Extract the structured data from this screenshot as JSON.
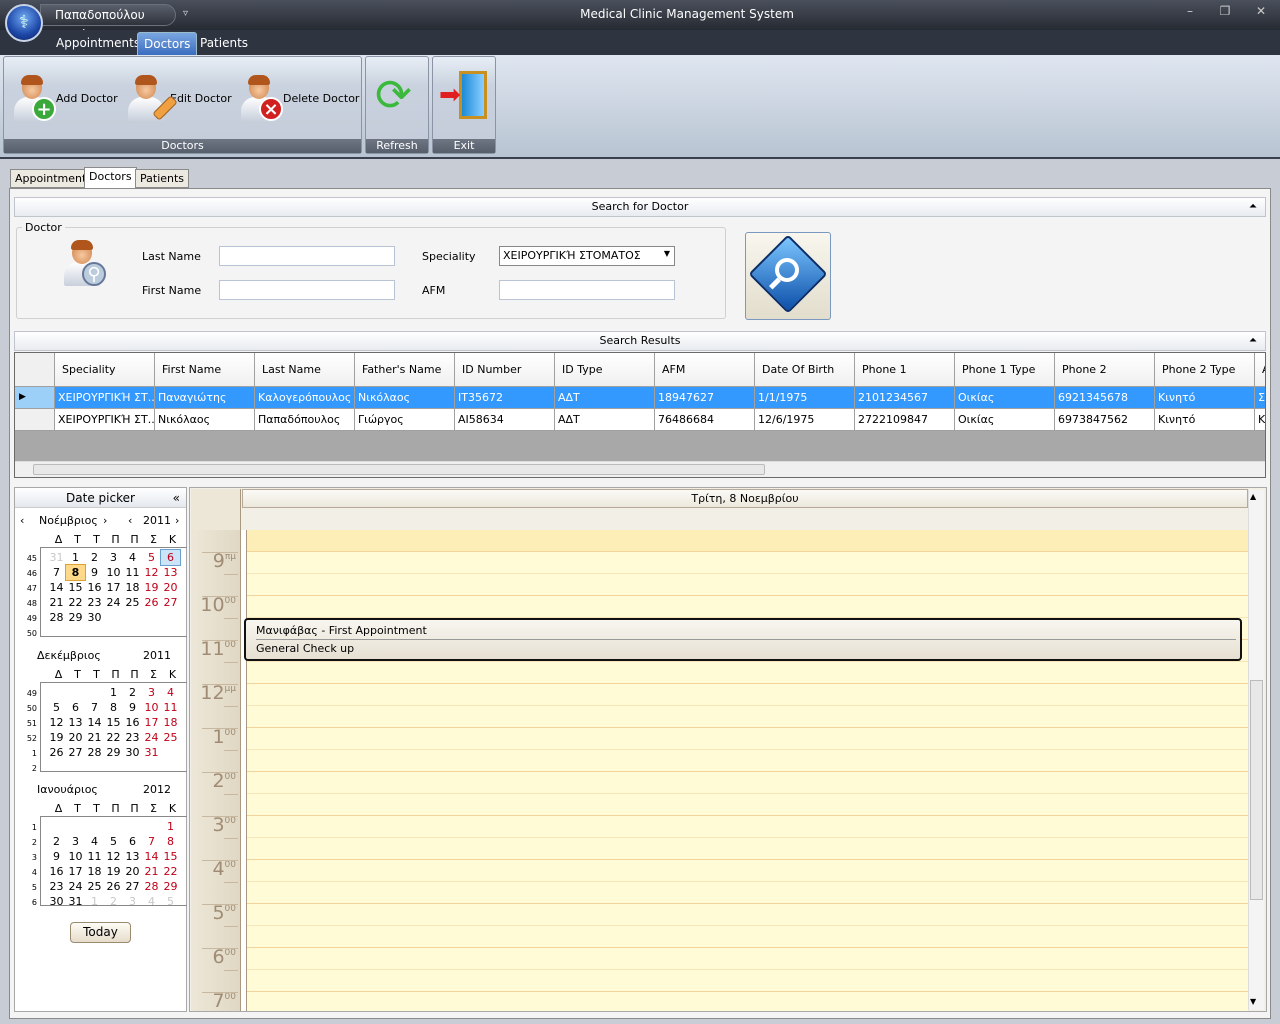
{
  "window": {
    "title": "Medical Clinic Management System",
    "user": "Παπαδοπούλου Μαρία",
    "minimize": "–",
    "restore": "❐",
    "close": "✕"
  },
  "ribbon": {
    "tabs": [
      "Appointments",
      "Doctors",
      "Patients"
    ],
    "active_tab": "Doctors",
    "groups": {
      "doctors": {
        "name": "Doctors",
        "add": "Add Doctor",
        "edit": "Edit Doctor",
        "delete": "Delete Doctor"
      },
      "refresh": {
        "name": "Refresh"
      },
      "exit": {
        "name": "Exit"
      }
    }
  },
  "tabs": [
    "Appointments",
    "Doctors",
    "Patients"
  ],
  "active_tab": "Doctors",
  "search": {
    "title": "Search for Doctor",
    "group": "Doctor",
    "last_name_label": "Last Name",
    "last_name": "",
    "first_name_label": "First Name",
    "first_name": "",
    "speciality_label": "Speciality",
    "speciality": "ΧΕΙΡΟΥΡΓΙΚΉ ΣΤΟΜΑΤΟΣ",
    "afm_label": "AFM",
    "afm": ""
  },
  "results": {
    "title": "Search Results",
    "columns": [
      "Speciality",
      "First Name",
      "Last Name",
      "Father's Name",
      "ID Number",
      "ID Type",
      "AFM",
      "Date Of Birth",
      "Phone 1",
      "Phone 1 Type",
      "Phone 2",
      "Phone 2 Type",
      "A"
    ],
    "rows": [
      [
        "ΧΕΙΡΟΥΡΓΙΚΉ ΣΤ...",
        "Παναγιώτης",
        "Καλογερόπουλος",
        "Νικόλαος",
        "IT35672",
        "ΑΔΤ",
        "18947627",
        "1/1/1975",
        "2101234567",
        "Οικίας",
        "6921345678",
        "Κινητό",
        "Σ"
      ],
      [
        "ΧΕΙΡΟΥΡΓΙΚΉ ΣΤ...",
        "Νικόλαος",
        "Παπαδόπουλος",
        "Γιώργος",
        "AI58634",
        "ΑΔΤ",
        "76486684",
        "12/6/1975",
        "2722109847",
        "Οικίας",
        "6973847562",
        "Κινητό",
        "Κ"
      ]
    ],
    "selected_row": 0
  },
  "datepicker": {
    "title": "Date picker",
    "collapse": "«",
    "today_label": "Today",
    "weekdays": [
      "Δ",
      "Τ",
      "Τ",
      "Π",
      "Π",
      "Σ",
      "Κ"
    ],
    "months": [
      {
        "name": "Νοέμβριος",
        "year": "2011",
        "weeks": [
          "45",
          "46",
          "47",
          "48",
          "49",
          "50"
        ],
        "lead": [
          "31"
        ],
        "days": 30,
        "trail": [],
        "today": 6,
        "selected": 8,
        "nav": true
      },
      {
        "name": "Δεκέμβριος",
        "year": "2011",
        "weeks": [
          "49",
          "50",
          "51",
          "52",
          "1",
          "2"
        ],
        "lead": [],
        "offset": 3,
        "days": 31,
        "trail": []
      },
      {
        "name": "Ιανουάριος",
        "year": "2012",
        "weeks": [
          "1",
          "2",
          "3",
          "4",
          "5",
          "6"
        ],
        "lead": [],
        "offset": 6,
        "days": 31,
        "trail": [
          "1",
          "2",
          "3",
          "4",
          "5"
        ]
      }
    ]
  },
  "schedule": {
    "day": "Τρίτη, 8 Νοεμβρίου",
    "hours": [
      [
        "9",
        "πμ"
      ],
      [
        "10",
        "00"
      ],
      [
        "11",
        "00"
      ],
      [
        "12",
        "μμ"
      ],
      [
        "1",
        "00"
      ],
      [
        "2",
        "00"
      ],
      [
        "3",
        "00"
      ],
      [
        "4",
        "00"
      ],
      [
        "5",
        "00"
      ],
      [
        "6",
        "00"
      ],
      [
        "7",
        "00"
      ]
    ],
    "appointment": {
      "title": "Μανιφάβας - First Appointment",
      "description": "General Check up"
    }
  },
  "colors": {
    "selection": "#3399ff",
    "weekend": "#c00018",
    "work_hours": "#fffbd6"
  }
}
